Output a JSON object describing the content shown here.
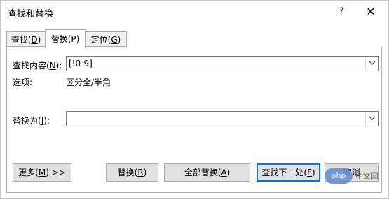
{
  "window": {
    "title": "查找和替换",
    "help": "?",
    "close": "✕"
  },
  "tabs": [
    {
      "label": "查找(D)",
      "text": "查找(",
      "key": "D",
      "after": ")"
    },
    {
      "label": "替换(P)",
      "text": "替换(",
      "key": "P",
      "after": ")",
      "active": true
    },
    {
      "label": "定位(G)",
      "text": "定位(",
      "key": "G",
      "after": ")"
    }
  ],
  "find": {
    "label_text": "查找内容(",
    "label_key": "N",
    "label_after": "):",
    "value": "[!0-9]"
  },
  "options": {
    "label": "选项:",
    "value": "区分全/半角"
  },
  "replace": {
    "label_text": "替换为(",
    "label_key": "I",
    "label_after": "):",
    "value": ""
  },
  "buttons": {
    "more": {
      "text": "更多(",
      "key": "M",
      "after": ") >>"
    },
    "replace": {
      "text": "替换(",
      "key": "R",
      "after": ")"
    },
    "replace_all": {
      "text": "全部替换(",
      "key": "A",
      "after": ")"
    },
    "find_next": {
      "text": "查找下一处(",
      "key": "F",
      "after": ")"
    },
    "cancel": {
      "text": "取消"
    }
  },
  "watermark": {
    "badge": "php",
    "text": "中文网"
  }
}
